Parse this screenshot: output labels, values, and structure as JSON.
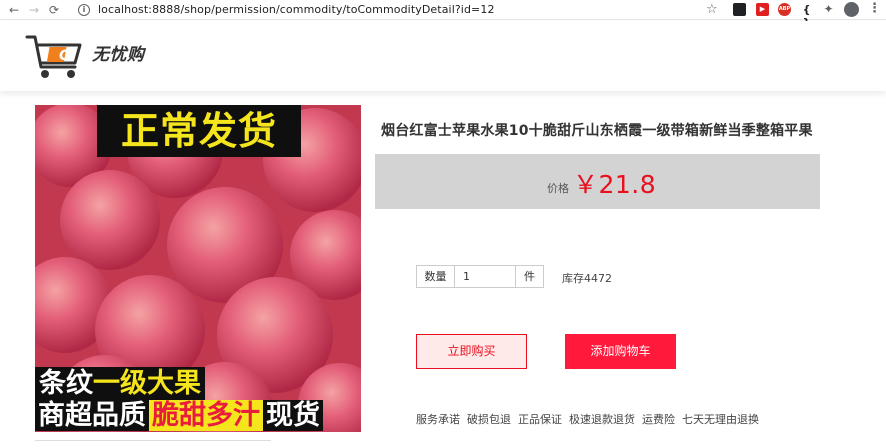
{
  "browser": {
    "url": "localhost:8888/shop/permission/commodity/toCommodityDetail?id=12",
    "ext_labels": [
      "",
      "▶",
      "ABP",
      "{ }",
      "✦"
    ]
  },
  "site": {
    "brand": "无忧购",
    "logo_letter": "G"
  },
  "product": {
    "image": {
      "banner_top": "正常发货",
      "line1_a": "条纹",
      "line1_b": "一级大果",
      "line2_a": "商超品质",
      "line2_b": "脆甜多汁",
      "line2_c": "现货"
    },
    "title": "烟台红富士苹果水果10十脆甜斤山东栖霞一级带箱新鲜当季整箱平果",
    "price_label": "价格",
    "price": "￥21.8",
    "quantity_label": "数量",
    "quantity_value": "1",
    "quantity_unit": "件",
    "stock": "库存4472",
    "buy_now": "立即购买",
    "add_to_cart": "添加购物车",
    "services": [
      "服务承诺",
      "破损包退",
      "正品保证",
      "极速退款退货",
      "运费险",
      "七天无理由退换"
    ]
  },
  "colors": {
    "accent_red": "#e8101e",
    "cart_button": "#ff1a3c",
    "price_box": "#d3d3d3",
    "logo_orange": "#f07f1d"
  }
}
